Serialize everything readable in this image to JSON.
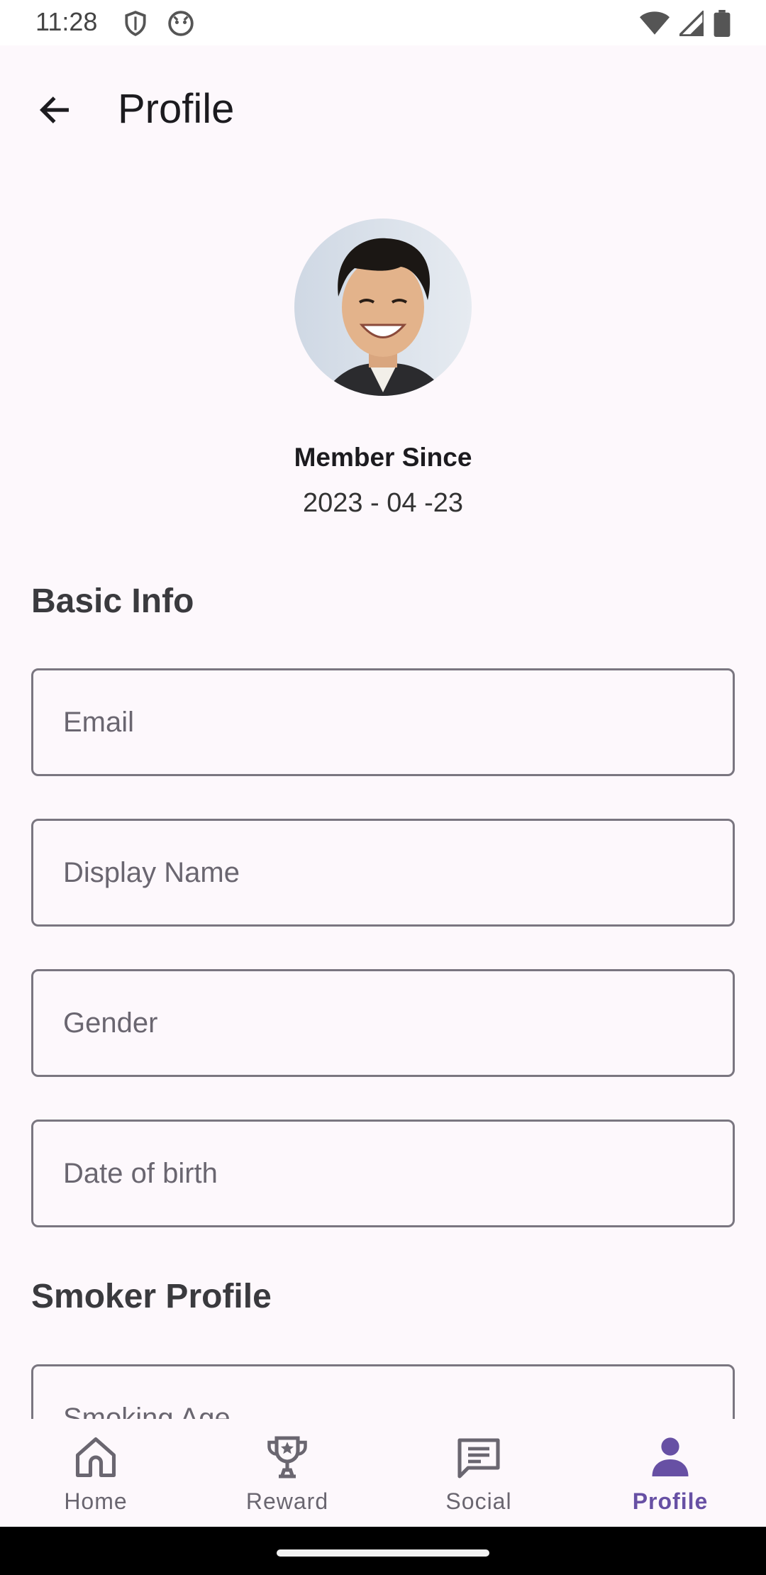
{
  "status_bar": {
    "time": "11:28",
    "icons_left": [
      "shield-icon",
      "android-face-icon"
    ],
    "icons_right": [
      "wifi-icon",
      "signal-icon",
      "battery-icon"
    ]
  },
  "app_bar": {
    "title": "Profile",
    "back_icon": "arrow-back-icon"
  },
  "profile": {
    "member_label": "Member Since",
    "member_date": "2023 - 04 -23"
  },
  "basic_info": {
    "title": "Basic Info",
    "fields": [
      {
        "placeholder": "Email",
        "value": ""
      },
      {
        "placeholder": "Display Name",
        "value": ""
      },
      {
        "placeholder": "Gender",
        "value": ""
      },
      {
        "placeholder": "Date of birth",
        "value": ""
      }
    ]
  },
  "smoker_profile": {
    "title": "Smoker Profile",
    "fields": [
      {
        "placeholder": "Smoking Age",
        "value": ""
      }
    ]
  },
  "bottom_nav": {
    "items": [
      {
        "label": "Home",
        "icon": "home-icon",
        "active": false
      },
      {
        "label": "Reward",
        "icon": "trophy-icon",
        "active": false
      },
      {
        "label": "Social",
        "icon": "chat-icon",
        "active": false
      },
      {
        "label": "Profile",
        "icon": "person-icon",
        "active": true
      }
    ]
  },
  "colors": {
    "background": "#fdf8fc",
    "accent": "#6750a4",
    "outline": "#7a7680",
    "text_secondary": "#6a6670"
  }
}
